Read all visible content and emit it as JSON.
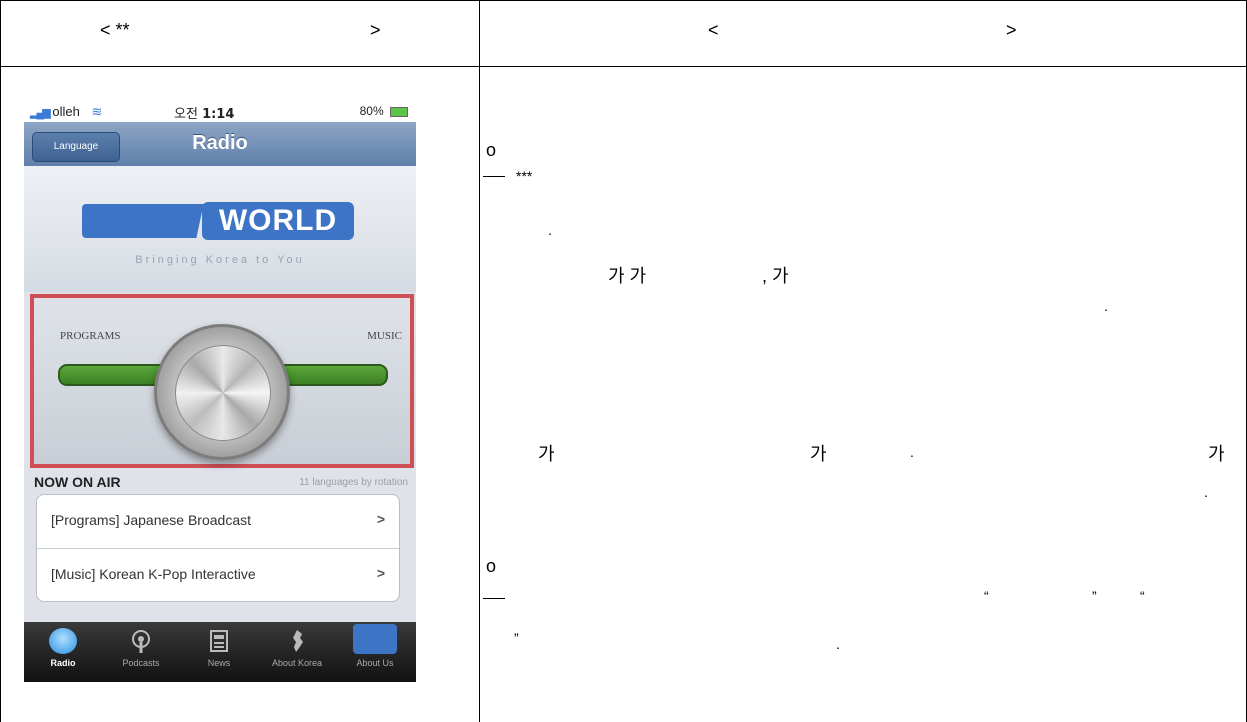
{
  "header": {
    "left_open": "< **",
    "left_close": ">",
    "right_open": "<",
    "right_close": ">"
  },
  "phone": {
    "status": {
      "carrier": "olleh",
      "time_prefix": "오전",
      "time": "1:14",
      "battery": "80%"
    },
    "navbar": {
      "language_button": "Language",
      "title": "Radio"
    },
    "logo": {
      "word": "WORLD",
      "tagline": "Bringing Korea to You"
    },
    "selector": {
      "left_label": "PROGRAMS",
      "right_label": "MUSIC"
    },
    "now_on_air": {
      "title": "NOW ON AIR",
      "subtitle": "11 languages by rotation",
      "items": [
        {
          "label": "[Programs] Japanese Broadcast"
        },
        {
          "label": "[Music] Korean K-Pop Interactive"
        }
      ]
    },
    "tabbar": {
      "tabs": [
        {
          "label": "Radio",
          "icon": "radio-icon"
        },
        {
          "label": "Podcasts",
          "icon": "podcast-icon"
        },
        {
          "label": "News",
          "icon": "news-icon"
        },
        {
          "label": "About Korea",
          "icon": "korea-map-icon"
        },
        {
          "label": "About Us",
          "icon": "about-us-icon"
        }
      ]
    }
  },
  "right": {
    "bullet1": "o",
    "stars": "***",
    "dot1": ".",
    "line_ga": "가 가",
    "comma_ga": ", 가",
    "dot2": ".",
    "ga_a": "가",
    "ga_b": "가",
    "dot3": ".",
    "ga_c": "가",
    "dot4": ".",
    "bullet2": "o",
    "quote_open1": "“",
    "quote_close1": "”",
    "quote_open2": "“",
    "quote_close2": "”",
    "dot5": "."
  }
}
